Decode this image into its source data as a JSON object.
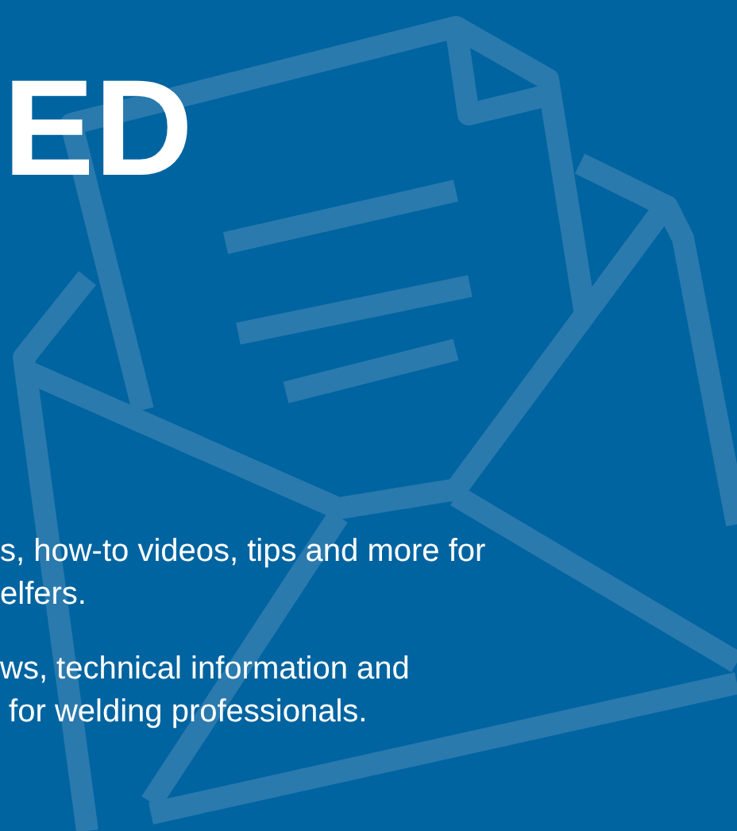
{
  "heading": "ED",
  "paragraphs": [
    {
      "lines": [
        "s, how-to videos, tips and more for",
        "elfers."
      ]
    },
    {
      "lines": [
        "ws, technical information and",
        " for welding professionals."
      ]
    }
  ]
}
